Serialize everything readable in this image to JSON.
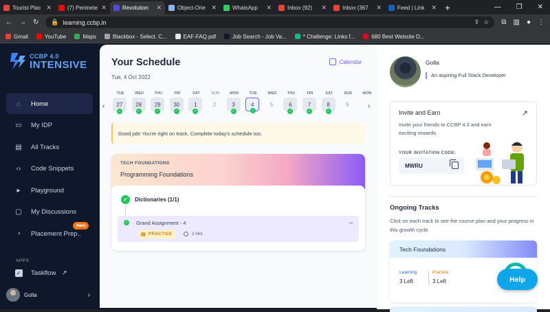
{
  "browser": {
    "tabs": [
      {
        "label": "Tourist Plac",
        "color": "#ea4335",
        "active": false
      },
      {
        "label": "(7) Perimete",
        "color": "#ff0000",
        "active": false
      },
      {
        "label": "Revolution",
        "color": "#4f46e5",
        "active": true
      },
      {
        "label": "Object-Orie",
        "color": "#8ab4f8",
        "active": false
      },
      {
        "label": "WhatsApp",
        "color": "#25d366",
        "active": false
      },
      {
        "label": "Inbox (92)",
        "color": "#ea4335",
        "active": false
      },
      {
        "label": "Inbox (367",
        "color": "#ea4335",
        "active": false
      },
      {
        "label": "Feed | Link",
        "color": "#0a66c2",
        "active": false
      }
    ],
    "url": "learning.ccbp.in",
    "bookmarks": [
      {
        "label": "Gmail",
        "color": "#ea4335"
      },
      {
        "label": "YouTube",
        "color": "#ff0000"
      },
      {
        "label": "Maps",
        "color": "#34a853"
      },
      {
        "label": "Blackbox - Select. C...",
        "color": "#9ca3af"
      },
      {
        "label": "EAF-FAQ.pdf",
        "color": "#e5e7eb"
      },
      {
        "label": "Job Search - Job Va...",
        "color": "#111827"
      },
      {
        "label": "* Challenge: Links f...",
        "color": "#10b981"
      },
      {
        "label": "680 Best Website D...",
        "color": "#e60023"
      }
    ]
  },
  "sidebar": {
    "logo_top": "CCBP 4.0",
    "logo_bottom": "INTENSIVE",
    "items": [
      {
        "label": "Home",
        "icon": "home-icon",
        "active": true
      },
      {
        "label": "My IDP",
        "icon": "idp-icon",
        "active": false
      },
      {
        "label": "All Tracks",
        "icon": "tracks-icon",
        "active": false
      },
      {
        "label": "Code Snippets",
        "icon": "code-icon",
        "active": false
      },
      {
        "label": "Playground",
        "icon": "terminal-icon",
        "active": false
      },
      {
        "label": "My Discussions",
        "icon": "discussions-icon",
        "active": false
      },
      {
        "label": "Placement Prep..",
        "icon": "placement-icon",
        "active": false
      }
    ],
    "new_badge": "New",
    "apps_label": "APPS",
    "app_item": "Taskflow",
    "user_name": "Golla"
  },
  "schedule": {
    "title": "Your Schedule",
    "date": "Tue, 4 Oct 2022",
    "calendar_label": "Calendar",
    "days": [
      {
        "dn": "TUE",
        "num": "27",
        "state": "done"
      },
      {
        "dn": "WED",
        "num": "28",
        "state": "done"
      },
      {
        "dn": "THU",
        "num": "29",
        "state": "done"
      },
      {
        "dn": "FRI",
        "num": "30",
        "state": "done"
      },
      {
        "dn": "SAT",
        "num": "1",
        "state": "done"
      },
      {
        "dn": "SUN",
        "num": "2",
        "state": "sun"
      },
      {
        "dn": "MON",
        "num": "3",
        "state": "done"
      },
      {
        "dn": "TUE",
        "num": "4",
        "state": "today"
      },
      {
        "dn": "WED",
        "num": "5",
        "state": "future"
      },
      {
        "dn": "THU",
        "num": "6",
        "state": "done"
      },
      {
        "dn": "FRI",
        "num": "7",
        "state": "done"
      },
      {
        "dn": "SAT",
        "num": "8",
        "state": "done"
      },
      {
        "dn": "SUN",
        "num": "9",
        "state": "future"
      },
      {
        "dn": "MON",
        "num": "",
        "state": "future"
      }
    ],
    "notice": "Good job! You're right on track. Complete today's schedule too.",
    "course": {
      "category": "TECH FOUNDATIONS",
      "name": "Programming Foundations",
      "topic": "Dictionaries (1/1)",
      "assignment": "Grand Assignment - 4",
      "tag": "PRACTICE",
      "duration": "2 Hrs"
    }
  },
  "profile": {
    "name": "Golla",
    "tagline": "An aspiring Full Stack Developer"
  },
  "invite": {
    "title": "Invite and Earn",
    "description": "Invite your friends to CCBP 4.0 and earn exciting rewards",
    "code_label": "YOUR INVITATION CODE:",
    "code": "MWRU"
  },
  "ongoing": {
    "title": "Ongoing Tracks",
    "description": "Click on each track to see the course plan and your progress in this growth cycle.",
    "track_name": "Tech Foundations",
    "learning_label": "Learning",
    "learning_value": "3 Left",
    "practice_label": "Practice",
    "practice_value": "3 Left"
  },
  "help_label": "Help",
  "colors": {
    "accent": "#6366f1",
    "success": "#22c55e",
    "sidebar_bg": "#0f172a",
    "help": "#0ea5e9",
    "learning": "#2563eb",
    "practice": "#d97706"
  }
}
